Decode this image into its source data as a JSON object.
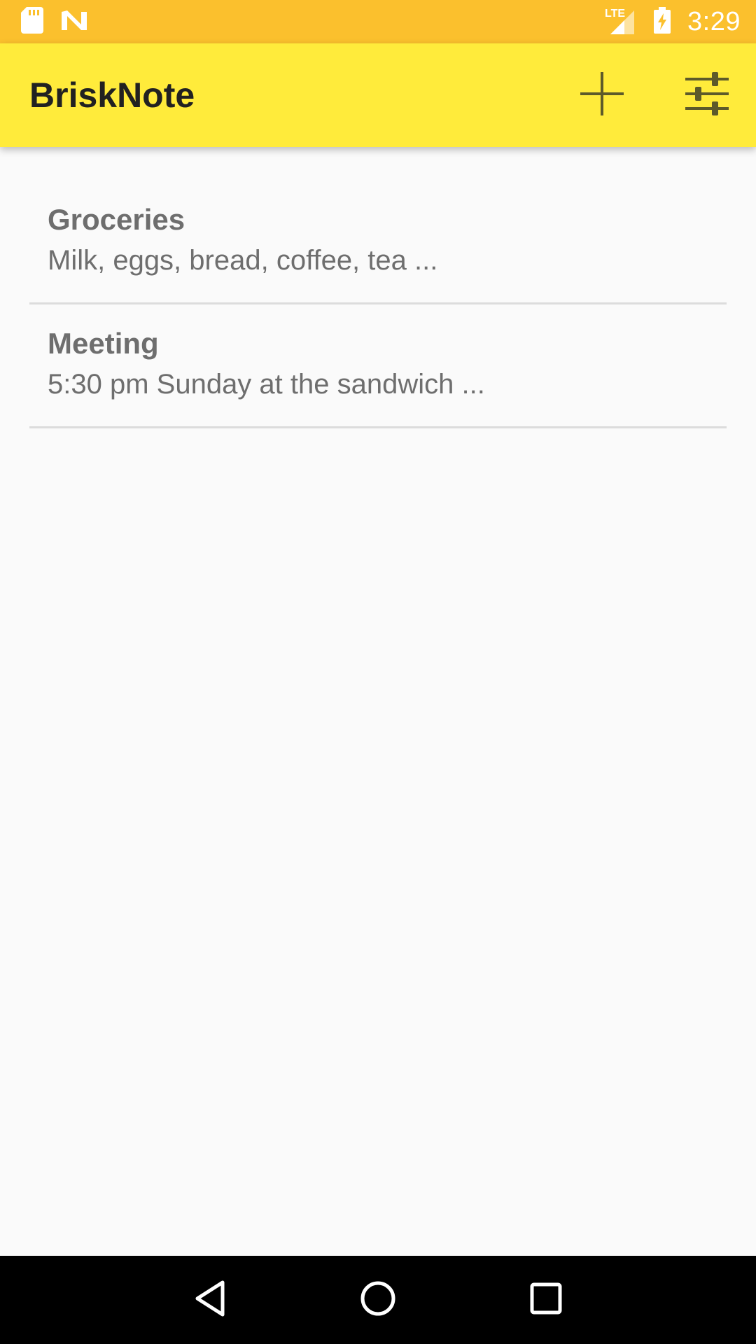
{
  "status_bar": {
    "time": "3:29",
    "network_label": "LTE",
    "icons": [
      "sd-card-icon",
      "notification-n-icon",
      "lte-signal-icon",
      "battery-charging-icon"
    ]
  },
  "app_bar": {
    "title": "BriskNote",
    "actions": [
      {
        "name": "add-note-button",
        "icon": "plus-icon"
      },
      {
        "name": "settings-button",
        "icon": "sliders-icon"
      }
    ]
  },
  "notes": [
    {
      "title": "Groceries",
      "preview": "Milk, eggs, bread, coffee, tea ..."
    },
    {
      "title": "Meeting",
      "preview": "5:30 pm Sunday at the sandwich ..."
    }
  ],
  "nav_bar": {
    "buttons": [
      "back-icon",
      "home-icon",
      "recents-icon"
    ]
  },
  "colors": {
    "status_bar": "#fbc02d",
    "app_bar": "#ffeb3b",
    "background": "#fafafa",
    "text_muted": "#6e6e6e",
    "icon_dark": "#5d5a2a"
  }
}
